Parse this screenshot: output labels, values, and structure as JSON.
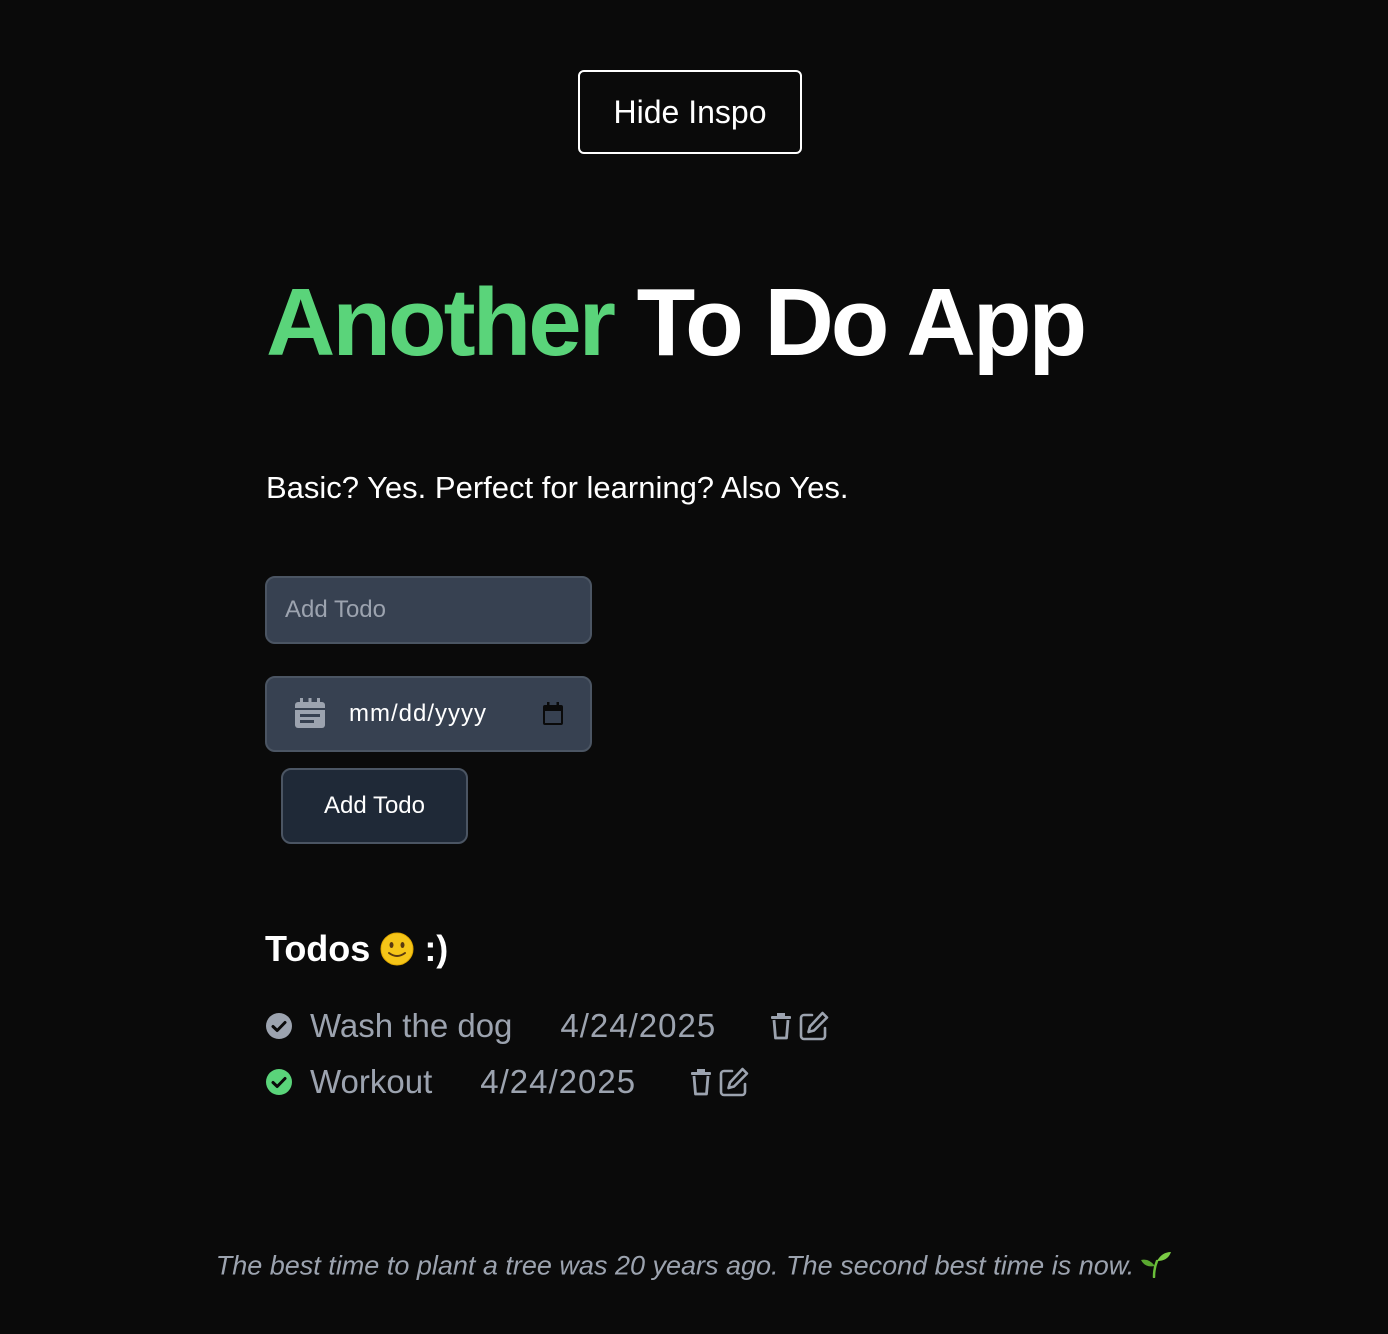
{
  "header": {
    "inspo_button_label": "Hide Inspo"
  },
  "hero": {
    "title_accent": "Another",
    "title_rest": "To Do App",
    "subtitle": "Basic? Yes. Perfect for learning? Also Yes."
  },
  "form": {
    "todo_placeholder": "Add Todo",
    "date_placeholder": "mm/dd/yyyy",
    "add_button_label": "Add Todo"
  },
  "todos": {
    "heading": "Todos",
    "heading_suffix": ":)",
    "heading_emoji": "slightly-smiling-face",
    "items": [
      {
        "text": "Wash the dog",
        "date": "4/24/2025",
        "completed_icon_color": "#9ca3af"
      },
      {
        "text": "Workout",
        "date": "4/24/2025",
        "completed_icon_color": "#5ad47a"
      }
    ]
  },
  "footer": {
    "quote": "The best time to plant a tree was 20 years ago. The second best time is now."
  },
  "colors": {
    "background": "#0a0a0a",
    "accent_green": "#5ad47a",
    "input_bg": "#374151",
    "button_bg": "#1f2937",
    "muted_text": "#9ca3af"
  }
}
